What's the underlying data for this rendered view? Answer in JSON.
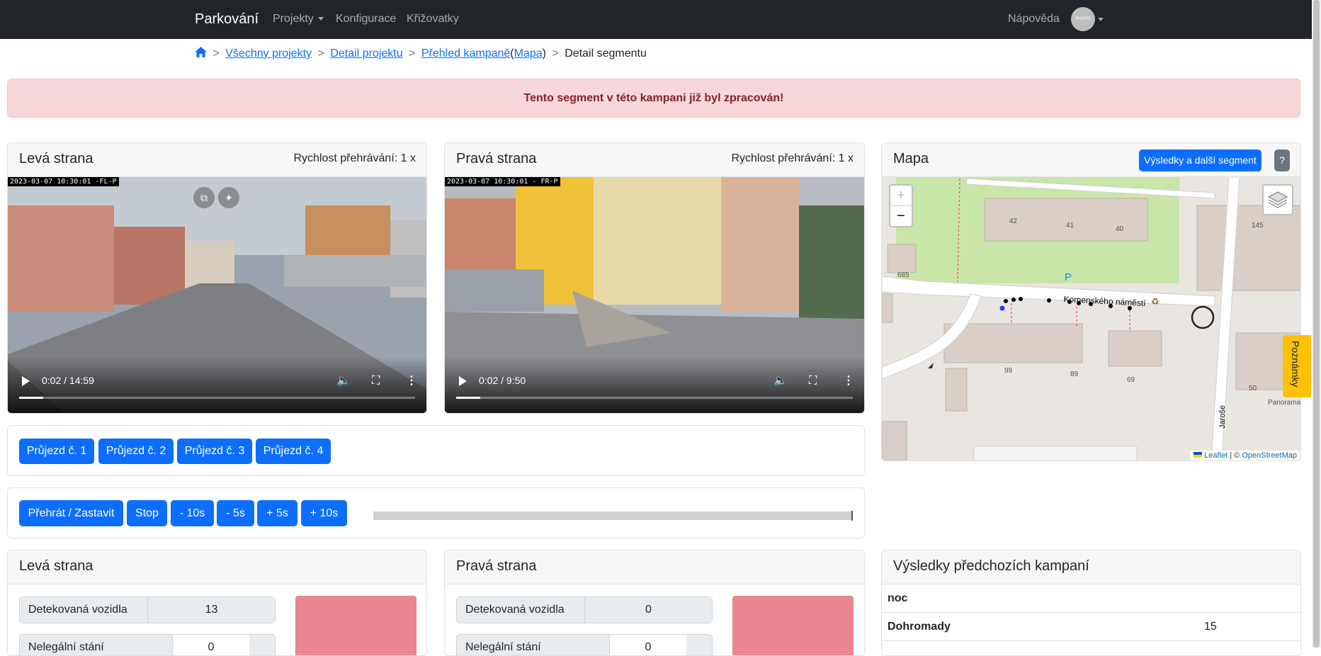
{
  "navbar": {
    "brand": "Parkování",
    "projects": "Projekty",
    "configuration": "Konfigurace",
    "intersections": "Křižovatky",
    "help": "Nápověda",
    "avatar_text": "PHOTO"
  },
  "breadcrumb": {
    "sep": ">",
    "all_projects": "Všechny projekty",
    "project_detail": "Detail projektu",
    "campaign_overview": "Přehled kampaně",
    "open_paren": "(",
    "map_link": "Mapa",
    "close_paren": ")",
    "current": "Detail segmentu"
  },
  "alert": {
    "text": "Tento segment v této kampani již byl zpracován!"
  },
  "left_video": {
    "title": "Levá strana",
    "speed": "Rychlost přehrávání: 1 x",
    "timestamp": "2023-03-07 10:30:01 -FL-P",
    "time": "0:02 / 14:59",
    "progress": 0.002
  },
  "right_video": {
    "title": "Pravá strana",
    "speed": "Rychlost přehrávání: 1 x",
    "timestamp": "2023-03-07 10:30:01 - FR-P",
    "time": "0:02 / 9:50",
    "progress": 0.003
  },
  "map": {
    "title": "Mapa",
    "next_button": "Výsledky a další segment",
    "help_button": "?",
    "zoom_in": "+",
    "zoom_out": "−",
    "street_name": "Komenského náměstí",
    "street2": "Jaroše",
    "house_numbers": [
      "42",
      "41",
      "40",
      "685",
      "145",
      "99",
      "89",
      "69",
      "50"
    ],
    "panorama_label": "Panorama",
    "parking_label": "P",
    "attribution_leaflet": "Leaflet",
    "attribution_sep": "| ©",
    "attribution_osm": "OpenStreetMap"
  },
  "notes_tab": "Poznámky",
  "passes": [
    "Průjezd č. 1",
    "Průjezd č. 2",
    "Průjezd č. 3",
    "Průjezd č. 4"
  ],
  "controls": [
    "Přehrát / Zastavit",
    "Stop",
    "- 10s",
    "- 5s",
    "+ 5s",
    "+ 10s"
  ],
  "left_stats": {
    "title": "Levá strana",
    "detected_label": "Detekovaná vozidla",
    "detected_value": "13",
    "illegal_label": "Nelegální stání",
    "illegal_value": "0"
  },
  "right_stats": {
    "title": "Pravá strana",
    "detected_label": "Detekovaná vozidla",
    "detected_value": "0",
    "illegal_label": "Nelegální stání",
    "illegal_value": "0"
  },
  "prev_results": {
    "title": "Výsledky předchozích kampaní",
    "rows": [
      {
        "label": "noc",
        "value": ""
      },
      {
        "label": "Dohromady",
        "value": "15"
      }
    ]
  },
  "colors": {
    "navbar": "#212529",
    "primary": "#0d6efd",
    "alert_bg": "#f8d7da",
    "alert_text": "#842029",
    "notes": "#ffc107",
    "pink": "#ea868f"
  }
}
